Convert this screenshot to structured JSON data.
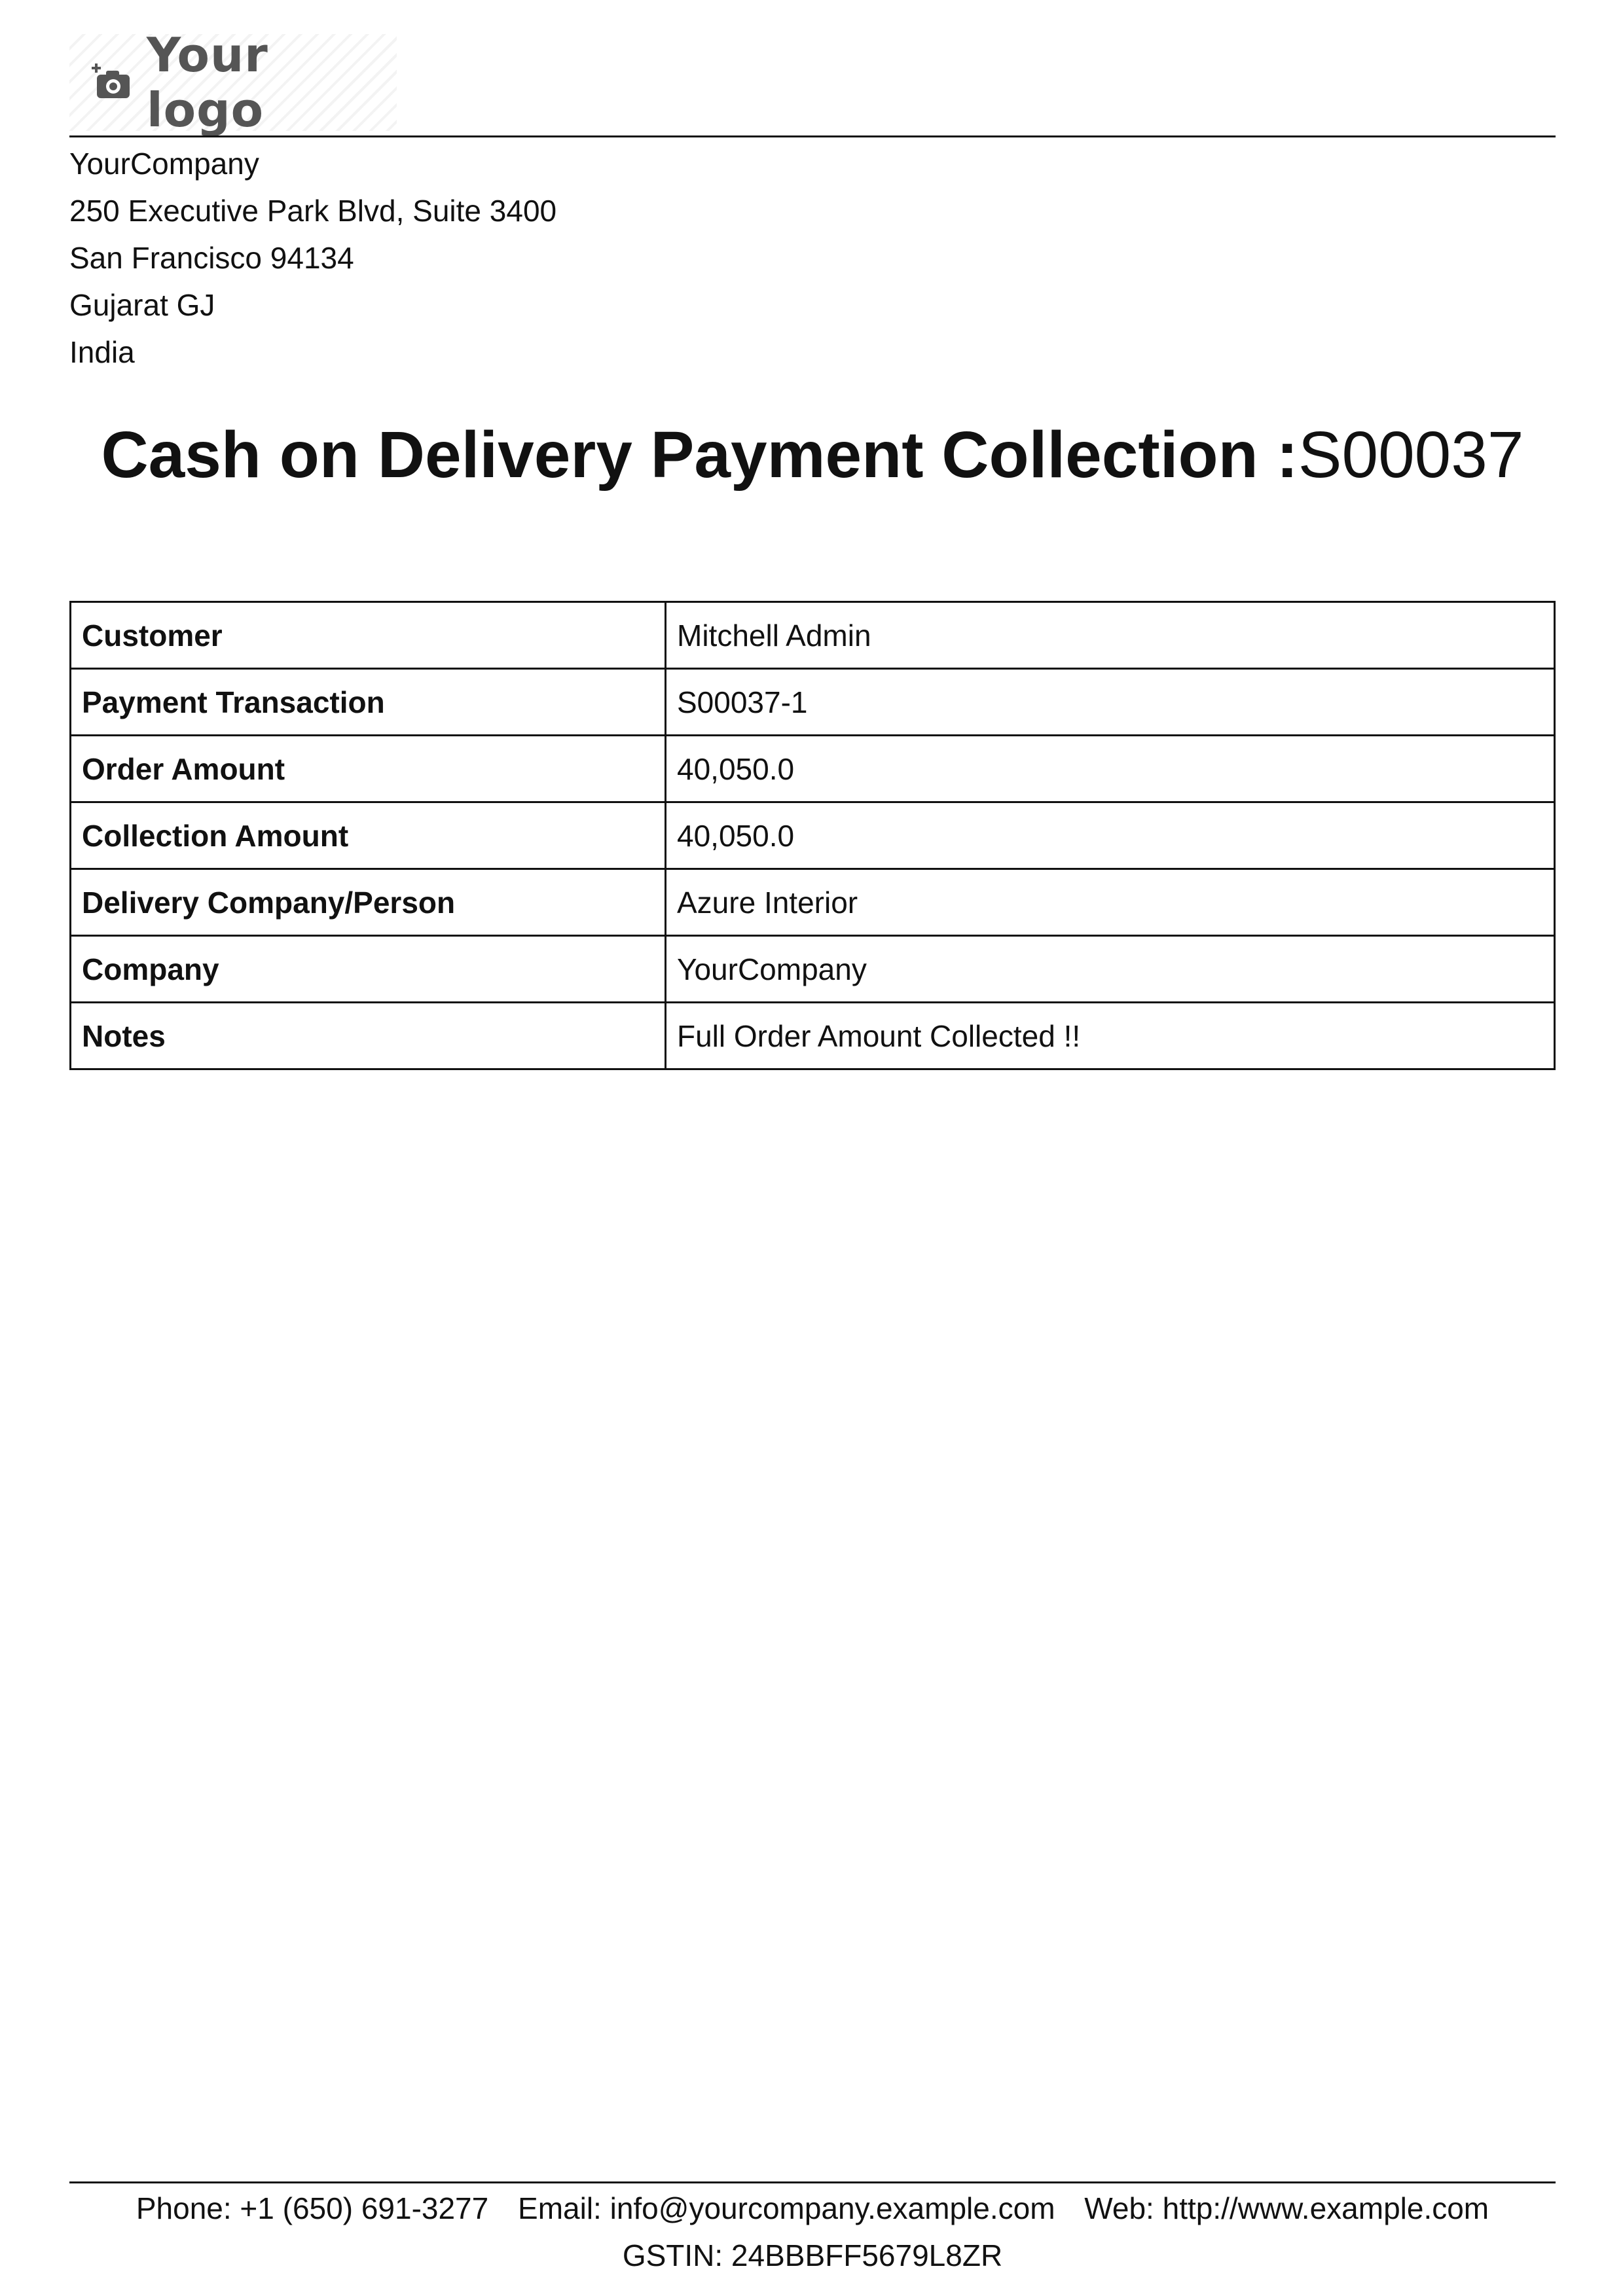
{
  "logo": {
    "text": "Your logo",
    "icon": "camera-plus-icon"
  },
  "company_address": {
    "name": "YourCompany",
    "street": "250 Executive Park Blvd, Suite 3400",
    "city_zip": "San Francisco 94134",
    "state": "Gujarat GJ",
    "country": "India"
  },
  "title": {
    "label": "Cash on Delivery Payment Collection :",
    "reference": "S00037"
  },
  "details": {
    "rows": [
      {
        "label": "Customer",
        "value": "Mitchell Admin"
      },
      {
        "label": "Payment Transaction",
        "value": "S00037-1"
      },
      {
        "label": "Order Amount",
        "value": "40,050.0"
      },
      {
        "label": "Collection Amount",
        "value": "40,050.0"
      },
      {
        "label": "Delivery Company/Person",
        "value": "Azure Interior"
      },
      {
        "label": "Company",
        "value": "YourCompany"
      },
      {
        "label": "Notes",
        "value": "Full Order Amount Collected !!"
      }
    ]
  },
  "footer": {
    "phone": "Phone: +1 (650) 691-3277",
    "email": "Email: info@yourcompany.example.com",
    "web": "Web: http://www.example.com",
    "gstin": "GSTIN: 24BBBFF5679L8ZR"
  },
  "colors": {
    "text": "#111111",
    "logo_gray": "#555555"
  }
}
